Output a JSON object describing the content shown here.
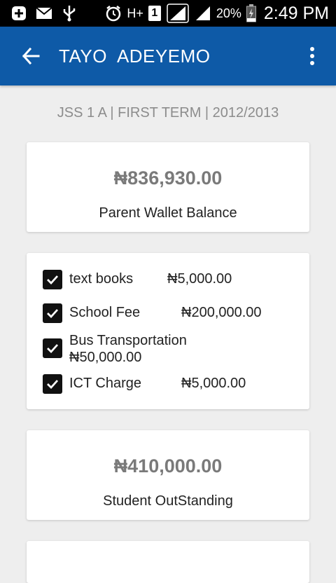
{
  "status_bar": {
    "battery": "20%",
    "time": "2:49 PM",
    "network_label": "H+",
    "sim_slot": "1"
  },
  "app_bar": {
    "title": "TAYO  ADEYEMO"
  },
  "subtitle": "JSS 1 A | FIRST TERM | 2012/2013",
  "wallet": {
    "amount": "₦836,930.00",
    "label": "Parent Wallet Balance"
  },
  "items": [
    {
      "name": "text books",
      "price": "₦5,000.00",
      "checked": true
    },
    {
      "name": "School Fee",
      "price": "₦200,000.00",
      "checked": true
    },
    {
      "name": "Bus Transportation",
      "price": "₦50,000.00",
      "checked": true
    },
    {
      "name": "ICT Charge",
      "price": "₦5,000.00",
      "checked": true
    }
  ],
  "outstanding": {
    "amount": "₦410,000.00",
    "label": "Student OutStanding"
  },
  "colors": {
    "app_bar": "#0e5aa7",
    "background": "#eeeeee",
    "checkbox": "#111111"
  }
}
